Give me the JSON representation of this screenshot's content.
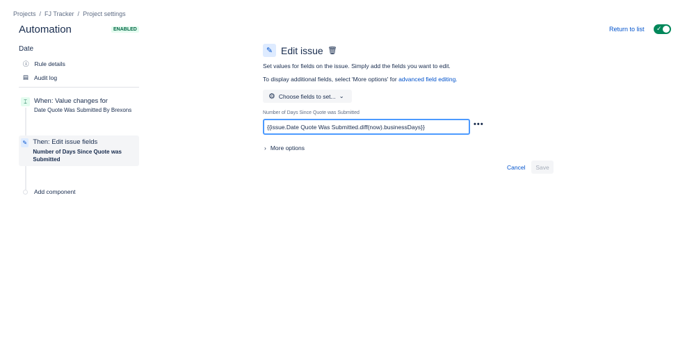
{
  "breadcrumb": [
    "Projects",
    "/",
    "FJ Tracker",
    "/",
    "Project settings"
  ],
  "header": {
    "title": "Automation",
    "status": "ENABLED",
    "return_label": "Return to list",
    "toggle_on": true
  },
  "sidebar": {
    "rule_name": "Date",
    "nav": [
      {
        "label": "Rule details",
        "icon": "info-icon"
      },
      {
        "label": "Audit log",
        "icon": "document-icon"
      }
    ],
    "steps": [
      {
        "title": "When: Value changes for",
        "subtitle": "Date Quote Was Submitted By Brexons"
      },
      {
        "title": "Then: Edit issue fields",
        "subtitle": "Number of Days Since Quote was Submitted"
      }
    ],
    "add_component": "Add component"
  },
  "main": {
    "title": "Edit issue",
    "desc1": "Set values for fields on the issue. Simply add the fields you want to edit.",
    "desc2": "To display additional fields, select 'More options' for ",
    "desc2_link": "advanced field editing.",
    "choose_label": "Choose fields to set...",
    "field_label": "Number of Days Since Quote was Submitted",
    "field_value": "{{issue.Date Quote Was Submitted.diff(now).businessDays}}",
    "more_options": "More options",
    "cancel": "Cancel",
    "save": "Save"
  }
}
